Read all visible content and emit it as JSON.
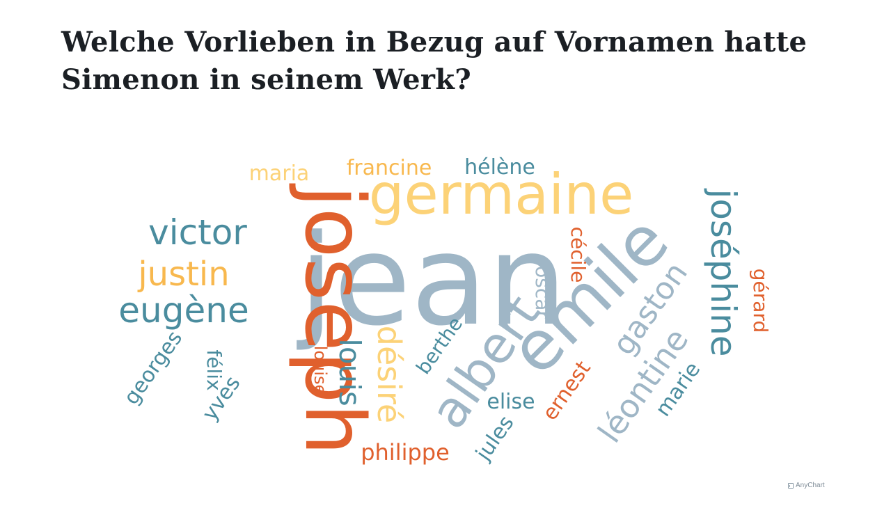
{
  "title": "Welche Vorlieben in Bezug auf Vornamen hatte Simenon in seinem Werk?",
  "credit": "AnyChart",
  "colors": {
    "slate": "#9fb6c6",
    "teal": "#4a8c9e",
    "orange": "#e0602d",
    "gold": "#fcd277",
    "amber": "#f8b84e"
  },
  "chart_data": {
    "type": "tagcloud",
    "words": [
      {
        "text": "jean",
        "weight": 100,
        "color": "slate"
      },
      {
        "text": "joseph",
        "weight": 80,
        "color": "orange"
      },
      {
        "text": "emile",
        "weight": 70,
        "color": "slate"
      },
      {
        "text": "germaine",
        "weight": 55,
        "color": "gold"
      },
      {
        "text": "albert",
        "weight": 50,
        "color": "slate"
      },
      {
        "text": "victor",
        "weight": 38,
        "color": "teal"
      },
      {
        "text": "eugène",
        "weight": 38,
        "color": "teal"
      },
      {
        "text": "joséphine",
        "weight": 38,
        "color": "teal"
      },
      {
        "text": "justin",
        "weight": 36,
        "color": "amber"
      },
      {
        "text": "désiré",
        "weight": 36,
        "color": "gold"
      },
      {
        "text": "léontine",
        "weight": 36,
        "color": "slate"
      },
      {
        "text": "louis",
        "weight": 34,
        "color": "teal"
      },
      {
        "text": "gaston",
        "weight": 34,
        "color": "slate"
      },
      {
        "text": "francine",
        "weight": 22,
        "color": "amber"
      },
      {
        "text": "maria",
        "weight": 22,
        "color": "gold"
      },
      {
        "text": "hélène",
        "weight": 22,
        "color": "teal"
      },
      {
        "text": "georges",
        "weight": 22,
        "color": "teal"
      },
      {
        "text": "félix",
        "weight": 22,
        "color": "teal"
      },
      {
        "text": "yves",
        "weight": 22,
        "color": "teal"
      },
      {
        "text": "oscar",
        "weight": 22,
        "color": "slate"
      },
      {
        "text": "cécile",
        "weight": 22,
        "color": "orange"
      },
      {
        "text": "berthe",
        "weight": 22,
        "color": "teal"
      },
      {
        "text": "elise",
        "weight": 22,
        "color": "teal"
      },
      {
        "text": "jules",
        "weight": 22,
        "color": "teal"
      },
      {
        "text": "ernest",
        "weight": 22,
        "color": "orange"
      },
      {
        "text": "philippe",
        "weight": 22,
        "color": "orange"
      },
      {
        "text": "marie",
        "weight": 22,
        "color": "teal"
      },
      {
        "text": "gérard",
        "weight": 20,
        "color": "orange"
      },
      {
        "text": "louise",
        "weight": 18,
        "color": "orange"
      }
    ]
  }
}
